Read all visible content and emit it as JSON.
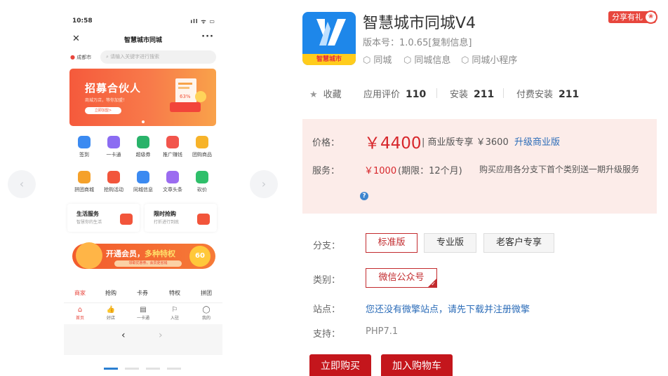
{
  "preview": {
    "status_time": "10:58",
    "status_icons": "ıll ᯤ ▭",
    "nav_title": "智慧城市同城",
    "nav_close": "✕",
    "nav_more": "···",
    "location": "成都市",
    "search_placeholder": "请输入关键字进行搜索",
    "banner": {
      "title": "招募合伙人",
      "subtitle": "商城万店，等你加盟！",
      "button": "立即加盟>",
      "badge": "63%"
    },
    "grid": [
      {
        "label": "签到",
        "color": "#3b8af1"
      },
      {
        "label": "一卡通",
        "color": "#8b6cf2"
      },
      {
        "label": "超级券",
        "color": "#29b36a"
      },
      {
        "label": "推广赚钱",
        "color": "#f2554c"
      },
      {
        "label": "团购商品",
        "color": "#f7b329"
      },
      {
        "label": "拼团商城",
        "color": "#f5a12a"
      },
      {
        "label": "抢购活动",
        "color": "#f2553b"
      },
      {
        "label": "同城信息",
        "color": "#3b8af1"
      },
      {
        "label": "文章头条",
        "color": "#9b6cf0"
      },
      {
        "label": "砍价",
        "color": "#2fbf6a"
      }
    ],
    "cards": [
      {
        "title": "生活服务",
        "subtitle": "智慧你的生活",
        "color": "#f2553b"
      },
      {
        "title": "限时抢购",
        "subtitle": "打折进行到底",
        "color": "#f2553b"
      }
    ],
    "vip": {
      "text_a": "开通会员，",
      "text_b": "多种特权",
      "sub": "领取优惠券，会员更省钱",
      "badge": "60"
    },
    "tabs": [
      "商家",
      "抢购",
      "卡券",
      "特权",
      "拼团"
    ],
    "bottom_nav": [
      {
        "label": "首页",
        "glyph": "⌂"
      },
      {
        "label": "好店",
        "glyph": "👍"
      },
      {
        "label": "一卡通",
        "glyph": "▤"
      },
      {
        "label": "入驻",
        "glyph": "⚐"
      },
      {
        "label": "我的",
        "glyph": "◯"
      }
    ],
    "browser_back": "‹",
    "browser_forward": "›"
  },
  "carousel": {
    "prev": "‹",
    "next": "›"
  },
  "app": {
    "logo_text": "智慧城市",
    "name": "智慧城市同城V4",
    "version": "版本号：1.0.65[复制信息]",
    "tags": [
      "同城",
      "同城信息",
      "同城小程序"
    ],
    "share_badge": "分享有礼"
  },
  "stats": {
    "favorite": "收藏",
    "rating_label": "应用评价",
    "rating_value": "110",
    "install_label": "安装",
    "install_value": "211",
    "paid_label": "付费安装",
    "paid_value": "211"
  },
  "pricing": {
    "price_label": "价格：",
    "price_value": "￥4400",
    "price_extra": "| 商业版专享 ￥3600",
    "upgrade_link": "升级商业版",
    "service_label": "服务：",
    "service_price": "￥1000",
    "service_period": "(期限：12个月)",
    "service_desc": "购买应用各分支下首个类别送一期升级服务",
    "help": "?"
  },
  "branch": {
    "label": "分支：",
    "options": [
      "标准版",
      "专业版",
      "老客户专享"
    ]
  },
  "category": {
    "label": "类别：",
    "option": "微信公众号"
  },
  "site": {
    "label": "站点：",
    "link": "您还没有微擎站点，请先下载并注册微擎"
  },
  "support": {
    "label": "支持：",
    "value": "PHP7.1"
  },
  "actions": {
    "buy": "立即购买",
    "cart": "加入购物车"
  },
  "colors": {
    "accent_red": "#c4161c",
    "price_red": "#d7262b",
    "link_blue": "#2b6cb8",
    "price_bg": "#fcece9"
  }
}
